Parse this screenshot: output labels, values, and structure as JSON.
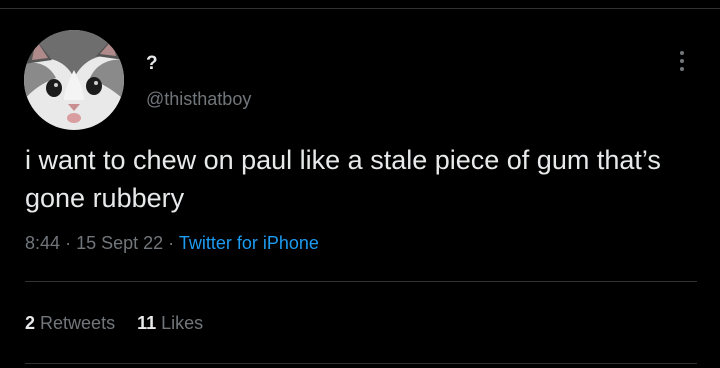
{
  "tweet": {
    "author": {
      "display_name": "?",
      "handle": "@thisthatboy",
      "avatar_icon": "kitten-photo"
    },
    "text": "i want to chew on paul like a stale piece of gum that’s gone rubbery",
    "time": "8:44",
    "separator": "·",
    "date": "15 Sept 22",
    "source": "Twitter for iPhone",
    "stats": {
      "retweets_count": "2",
      "retweets_label": "Retweets",
      "likes_count": "11",
      "likes_label": "Likes"
    }
  },
  "colors": {
    "background": "#000000",
    "text": "#e7e9ea",
    "muted": "#71767b",
    "link": "#1d9bf0",
    "divider": "#2f3336"
  }
}
